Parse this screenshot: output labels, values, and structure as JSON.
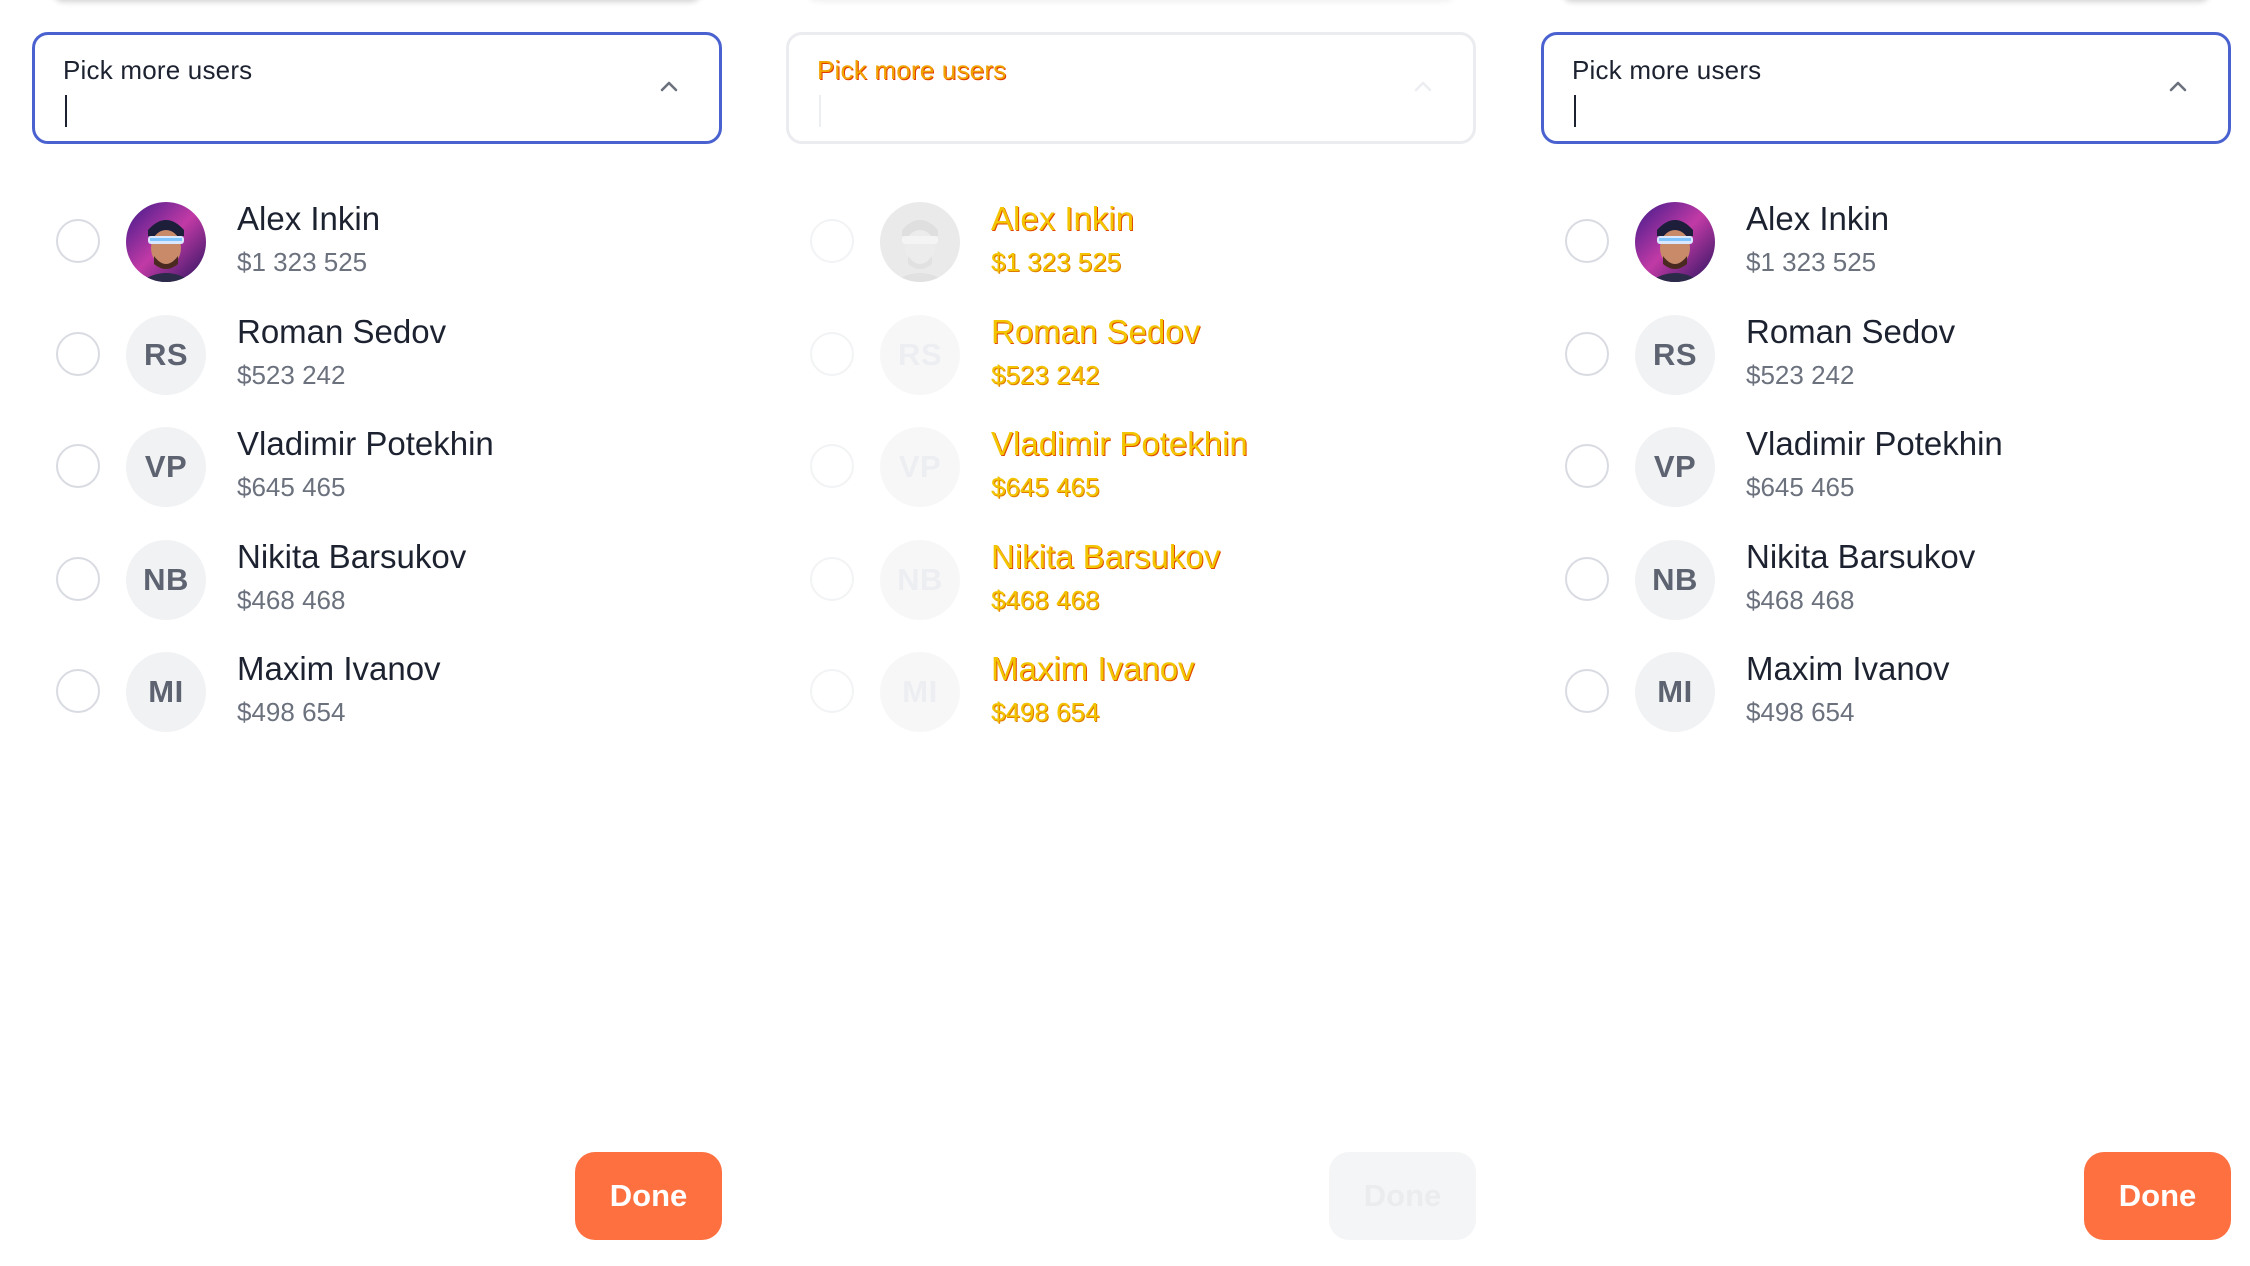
{
  "panels": [
    {
      "state": "active",
      "picker": {
        "label": "Pick more users"
      },
      "users": [
        {
          "name": "Alex Inkin",
          "amount": "$1 323 525",
          "avatar": "photo",
          "initials": ""
        },
        {
          "name": "Roman Sedov",
          "amount": "$523 242",
          "avatar": "initials",
          "initials": "RS"
        },
        {
          "name": "Vladimir Potekhin",
          "amount": "$645 465",
          "avatar": "initials",
          "initials": "VP"
        },
        {
          "name": "Nikita Barsukov",
          "amount": "$468 468",
          "avatar": "initials",
          "initials": "NB"
        },
        {
          "name": "Maxim Ivanov",
          "amount": "$498 654",
          "avatar": "initials",
          "initials": "MI"
        }
      ],
      "done_label": "Done"
    },
    {
      "state": "disabled",
      "picker": {
        "label": "Pick more users"
      },
      "users": [
        {
          "name": "Alex Inkin",
          "amount": "$1 323 525",
          "avatar": "photo",
          "initials": ""
        },
        {
          "name": "Roman Sedov",
          "amount": "$523 242",
          "avatar": "initials",
          "initials": "RS"
        },
        {
          "name": "Vladimir Potekhin",
          "amount": "$645 465",
          "avatar": "initials",
          "initials": "VP"
        },
        {
          "name": "Nikita Barsukov",
          "amount": "$468 468",
          "avatar": "initials",
          "initials": "NB"
        },
        {
          "name": "Maxim Ivanov",
          "amount": "$498 654",
          "avatar": "initials",
          "initials": "MI"
        }
      ],
      "done_label": "Done"
    },
    {
      "state": "active",
      "picker": {
        "label": "Pick more users"
      },
      "users": [
        {
          "name": "Alex Inkin",
          "amount": "$1 323 525",
          "avatar": "photo",
          "initials": ""
        },
        {
          "name": "Roman Sedov",
          "amount": "$523 242",
          "avatar": "initials",
          "initials": "RS"
        },
        {
          "name": "Vladimir Potekhin",
          "amount": "$645 465",
          "avatar": "initials",
          "initials": "VP"
        },
        {
          "name": "Nikita Barsukov",
          "amount": "$468 468",
          "avatar": "initials",
          "initials": "NB"
        },
        {
          "name": "Maxim Ivanov",
          "amount": "$498 654",
          "avatar": "initials",
          "initials": "MI"
        }
      ],
      "done_label": "Done"
    }
  ],
  "colors": {
    "focus_border": "#4a62d0",
    "done_button": "#ff7040",
    "text_primary": "#1d2230",
    "text_secondary": "#6b717d"
  },
  "icons": {
    "chevron": "chevron-up-icon",
    "radio": "radio-unchecked-icon"
  }
}
